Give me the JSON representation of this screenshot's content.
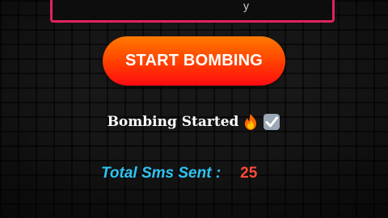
{
  "input": {
    "value": "y"
  },
  "button": {
    "label": "START BOMBING"
  },
  "status": {
    "text": "Bombing Started",
    "icons": [
      "fire-icon",
      "check-mark-icon"
    ]
  },
  "counter": {
    "label": "Total Sms Sent :",
    "value": "25"
  },
  "colors": {
    "input_border": "#e0245e",
    "button_gradient_top": "#ff7a00",
    "button_gradient_bottom": "#ff0a12",
    "counter_label": "#2ec3f0",
    "counter_value": "#ff4a3a"
  }
}
